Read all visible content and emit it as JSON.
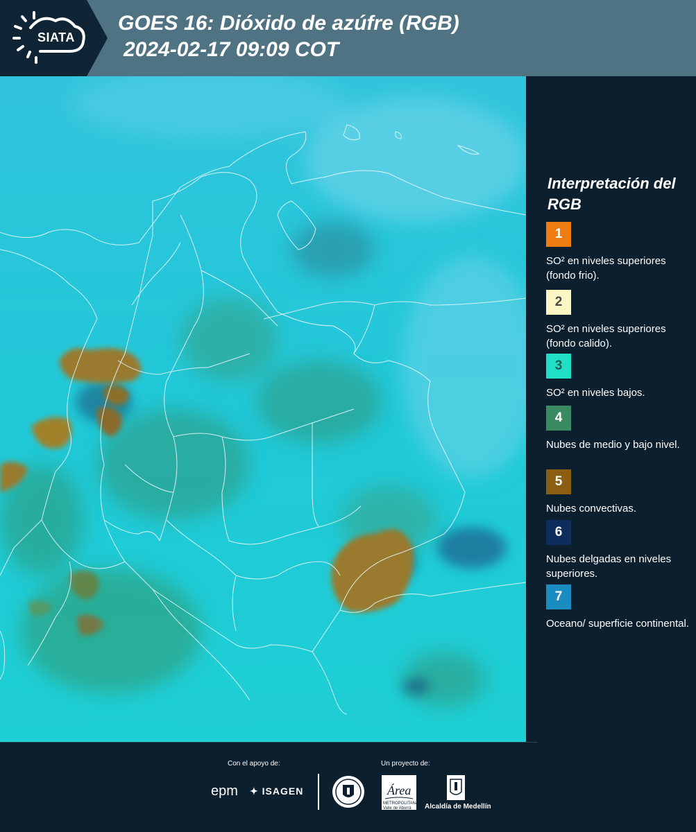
{
  "header": {
    "logo_text": "SIATA",
    "title": "GOES 16: Dióxido de azúfre (RGB)",
    "subtitle": "2024-02-17 09:09 COT"
  },
  "legend": {
    "title": "Interpretación del RGB",
    "items": [
      {
        "number": "1",
        "label": "SO² en niveles superiores (fondo frio).",
        "color": "#f07d12",
        "text_color": "#ffffff"
      },
      {
        "number": "2",
        "label": "SO² en niveles superiores (fondo calido).",
        "color": "#fcf6c4",
        "text_color": "#4a4a4a"
      },
      {
        "number": "3",
        "label": "SO² en niveles bajos.",
        "color": "#1fe0c4",
        "text_color": "#1e5f57"
      },
      {
        "number": "4",
        "label": "Nubes de medio y bajo nivel.",
        "color": "#3a8a62",
        "text_color": "#ffffff"
      },
      {
        "number": "5",
        "label": "Nubes convectivas.",
        "color": "#8b5e12",
        "text_color": "#ffffff"
      },
      {
        "number": "6",
        "label": "Nubes delgadas en niveles superiores.",
        "color": "#0f2d5c",
        "text_color": "#ffffff"
      },
      {
        "number": "7",
        "label": "Oceano/ superficie continental.",
        "color": "#1a8cbf",
        "text_color": "#ffffff"
      }
    ]
  },
  "footer": {
    "support_label": "Con el apoyo de:",
    "project_label": "Un proyecto de:",
    "epm": "epm",
    "isagen": "ISAGEN",
    "area_name": "Área",
    "area_sub": "METROPOLITANA Valle de Aburrá",
    "alcaldia": "Alcaldía de Medellín"
  },
  "colors": {
    "header_bg": "#4f7383",
    "panel_bg": "#0b1f2e",
    "map_base": "#1fc8d8"
  }
}
